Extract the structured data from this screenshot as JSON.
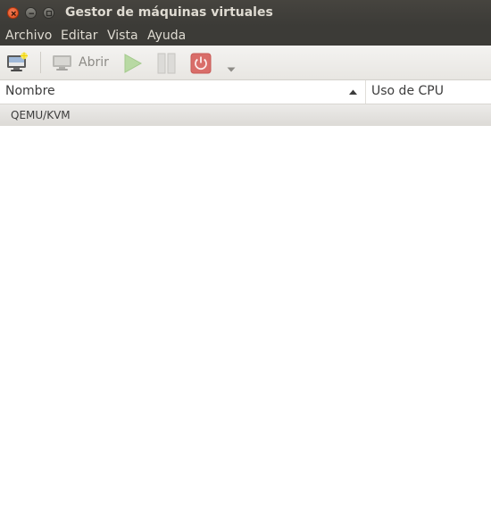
{
  "window": {
    "title": "Gestor de máquinas virtuales"
  },
  "menu": {
    "items": [
      "Archivo",
      "Editar",
      "Vista",
      "Ayuda"
    ]
  },
  "toolbar": {
    "new_vm_icon": "new-vm-icon",
    "open_label": "Abrir",
    "open_icon": "monitor-icon",
    "run_icon": "play-icon",
    "pause_icon": "pause-icon",
    "shutdown_icon": "power-icon",
    "more_icon": "dropdown-arrow-icon"
  },
  "table": {
    "columns": [
      "Nombre",
      "Uso de CPU"
    ],
    "sort_icon": "sort-ascending-icon",
    "rows": [
      {
        "name": "QEMU/KVM"
      }
    ]
  },
  "colors": {
    "titlebar": "#3c3b37",
    "close_button": "#df4a16",
    "run_button": "#8ec56b",
    "power_button": "#d86a66"
  }
}
